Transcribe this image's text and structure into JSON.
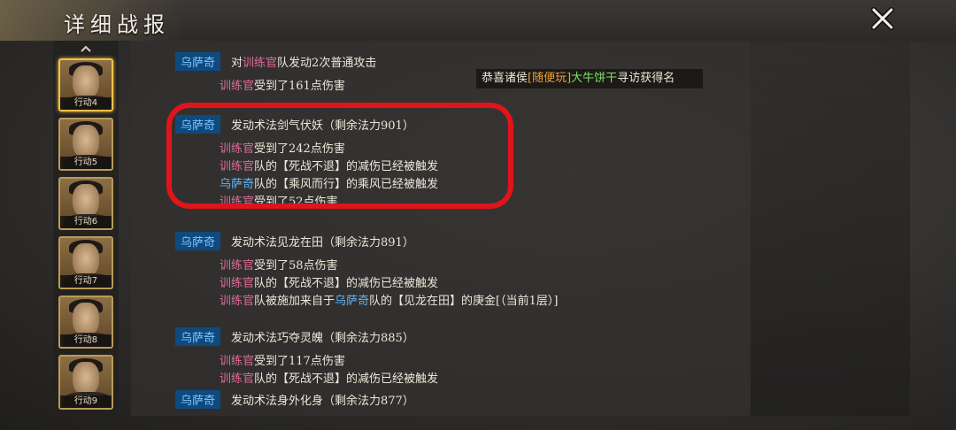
{
  "header": {
    "title": "详细战报"
  },
  "sidebar": {
    "items": [
      {
        "label": "行动4",
        "selected": true
      },
      {
        "label": "行动5",
        "selected": false
      },
      {
        "label": "行动6",
        "selected": false
      },
      {
        "label": "行动7",
        "selected": false
      },
      {
        "label": "行动8",
        "selected": false
      },
      {
        "label": "行动9",
        "selected": false
      }
    ]
  },
  "notice": {
    "prefix": "恭喜诸侯",
    "player": "[随便玩]",
    "item": "大牛饼干",
    "suffix": "寻访获得名"
  },
  "log": {
    "r0": {
      "badge": "乌萨奇",
      "pre": "对",
      "target": "训练官",
      "post": "队发动2次普通攻击"
    },
    "r1": {
      "name": "训练官",
      "text": "受到了161点伤害"
    },
    "r2": {
      "badge": "乌萨奇",
      "text": "发动术法剑气伏妖（剩余法力901）"
    },
    "r3": {
      "name": "训练官",
      "text": "受到了242点伤害"
    },
    "r4": {
      "name": "训练官",
      "text": "队的【死战不退】的减伤已经被触发"
    },
    "r5": {
      "name": "乌萨奇",
      "text": "队的【乘风而行】的乘风已经被触发"
    },
    "r6": {
      "name": "训练官",
      "text": "受到了52点伤害"
    },
    "r7": {
      "badge": "乌萨奇",
      "text": "发动术法见龙在田（剩余法力891）"
    },
    "r8": {
      "name": "训练官",
      "text": "受到了58点伤害"
    },
    "r9": {
      "name": "训练官",
      "text": "队的【死战不退】的减伤已经被触发"
    },
    "r10": {
      "name": "训练官",
      "pre": "队被施加来自于",
      "source": "乌萨奇",
      "post": "队的【见龙在田】的庚金[（当前1层）]"
    },
    "r11": {
      "badge": "乌萨奇",
      "text": "发动术法巧夺灵魄（剩余法力885）"
    },
    "r12": {
      "name": "训练官",
      "text": "受到了117点伤害"
    },
    "r13": {
      "name": "训练官",
      "text": "队的【死战不退】的减伤已经被触发"
    },
    "r14": {
      "badge": "乌萨奇",
      "text": "发动术法身外化身（剩余法力877）"
    }
  },
  "colors": {
    "enemy_name": "#e06a9c",
    "ally_name": "#62b5f5",
    "badge_bg": "#0e4a7e",
    "highlight": "#e0141b"
  },
  "icons": {
    "close": "close-x-icon",
    "scroll_up": "chevron-up-icon"
  }
}
